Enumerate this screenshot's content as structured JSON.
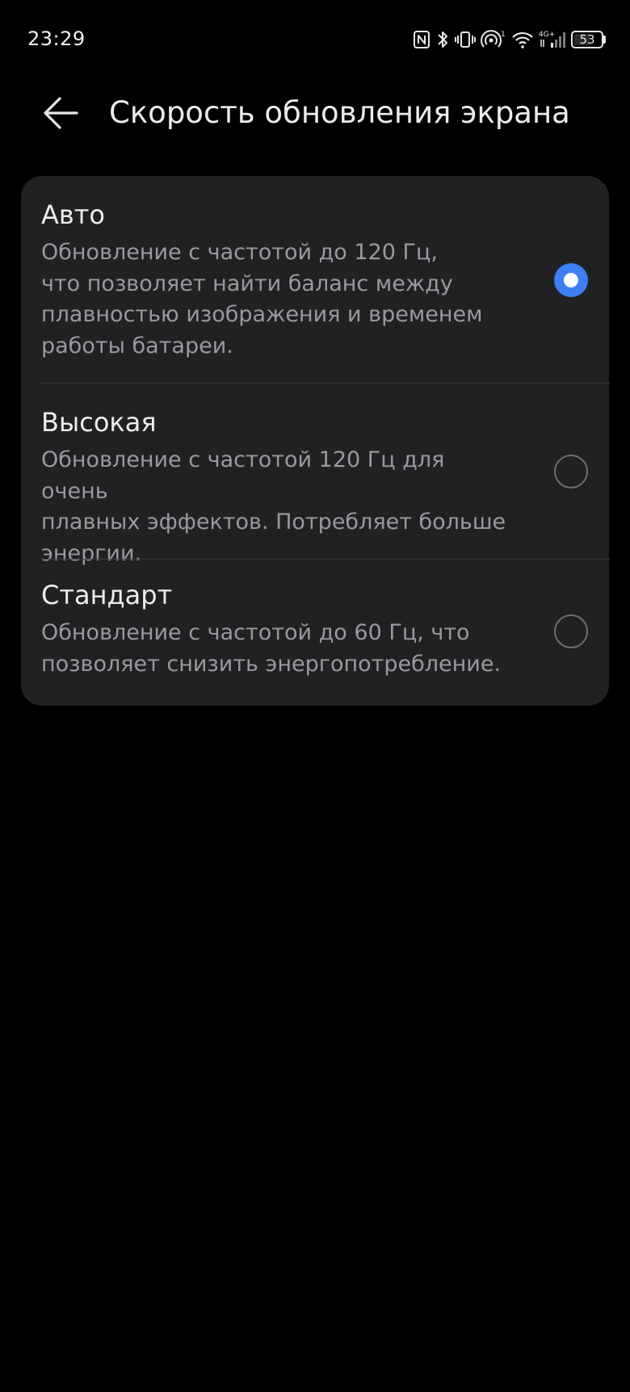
{
  "status_bar": {
    "time": "23:29",
    "battery_level": "53",
    "icons": [
      "nfc-icon",
      "bluetooth-icon",
      "vibrate-icon",
      "hotspot-icon",
      "wifi-icon",
      "cellular-signal-icon",
      "battery-icon"
    ],
    "network_label": "4G⁺"
  },
  "header": {
    "title": "Скорость обновления экрана",
    "back_icon": "arrow-left-icon"
  },
  "options": [
    {
      "title": "Авто",
      "description": "Обновление с частотой до 120 Гц,\nчто позволяет найти баланс между\nплавностью изображения и временем\nработы батареи.",
      "selected": true
    },
    {
      "title": "Высокая",
      "description": "Обновление с частотой 120 Гц для очень\nплавных эффектов. Потребляет больше\nэнергии.",
      "selected": false
    },
    {
      "title": "Стандарт",
      "description": "Обновление с частотой до 60 Гц, что\nпозволяет снизить энергопотребление.",
      "selected": false
    }
  ],
  "colors": {
    "background": "#000000",
    "card": "#212124",
    "accent": "#3d7ef2",
    "title_text": "#ededed",
    "secondary_text": "#9a9a9e"
  }
}
